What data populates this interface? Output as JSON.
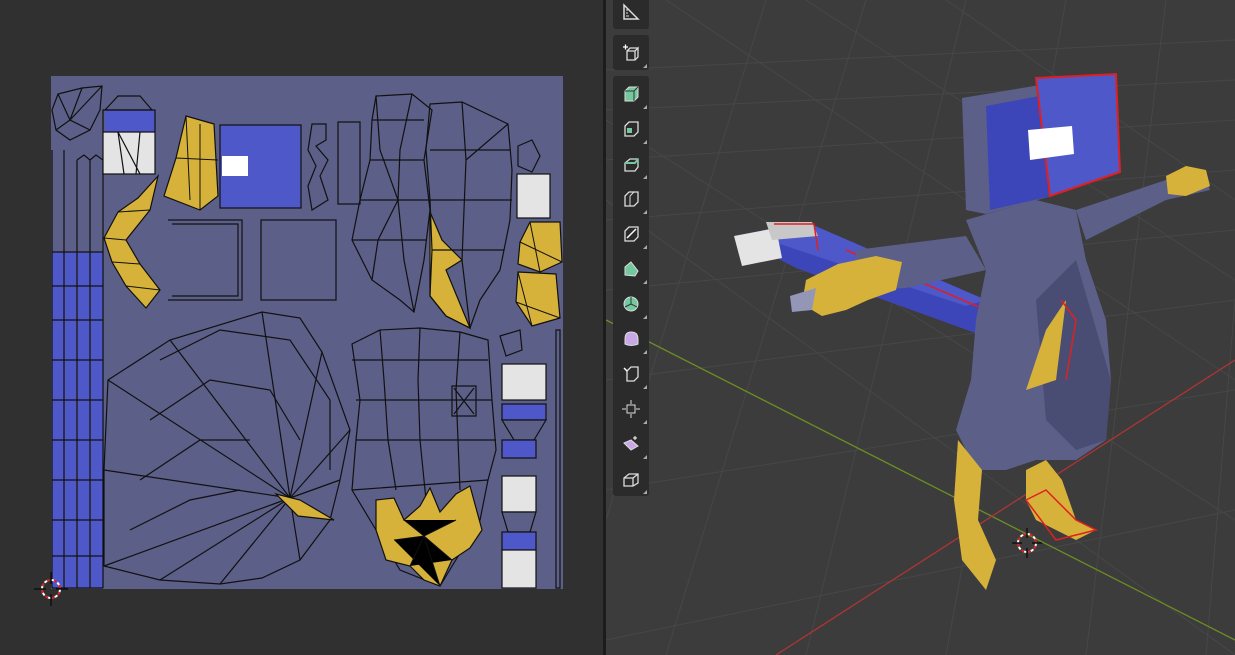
{
  "colors": {
    "uv_background": "#5c5f88",
    "editor_background": "#303030",
    "viewport_background": "#3c3c3c",
    "accent_blue": "#4f58c8",
    "accent_yellow": "#d6b23a",
    "accent_white": "#e4e4e4",
    "selection_red": "#e02020",
    "axis_x_red": "#b23434",
    "axis_y_green": "#6b8e23",
    "toolbar_bg": "#2b2b2b",
    "tool_green": "#73c8a0",
    "tool_purple": "#c9a8e8"
  },
  "uv_editor": {
    "cursor_icon": "2d-cursor-icon"
  },
  "viewport": {
    "toolbar": [
      {
        "name": "measure-tool",
        "icon": "measure-icon"
      },
      {
        "name": "add-cube-tool",
        "icon": "add-cube-icon"
      },
      {
        "name": "extrude-region-tool",
        "icon": "extrude-region-icon"
      },
      {
        "name": "inset-faces-tool",
        "icon": "inset-faces-icon"
      },
      {
        "name": "bevel-tool",
        "icon": "bevel-icon"
      },
      {
        "name": "loop-cut-tool",
        "icon": "loop-cut-icon"
      },
      {
        "name": "knife-tool",
        "icon": "knife-icon"
      },
      {
        "name": "poly-build-tool",
        "icon": "poly-build-icon"
      },
      {
        "name": "spin-tool",
        "icon": "spin-icon"
      },
      {
        "name": "smooth-tool",
        "icon": "smooth-icon"
      },
      {
        "name": "edge-slide-tool",
        "icon": "edge-slide-icon"
      },
      {
        "name": "shrink-fatten-tool",
        "icon": "shrink-fatten-icon"
      },
      {
        "name": "shear-tool",
        "icon": "shear-icon"
      },
      {
        "name": "rip-region-tool",
        "icon": "rip-region-icon"
      }
    ],
    "cursor_icon": "3d-cursor-icon"
  }
}
